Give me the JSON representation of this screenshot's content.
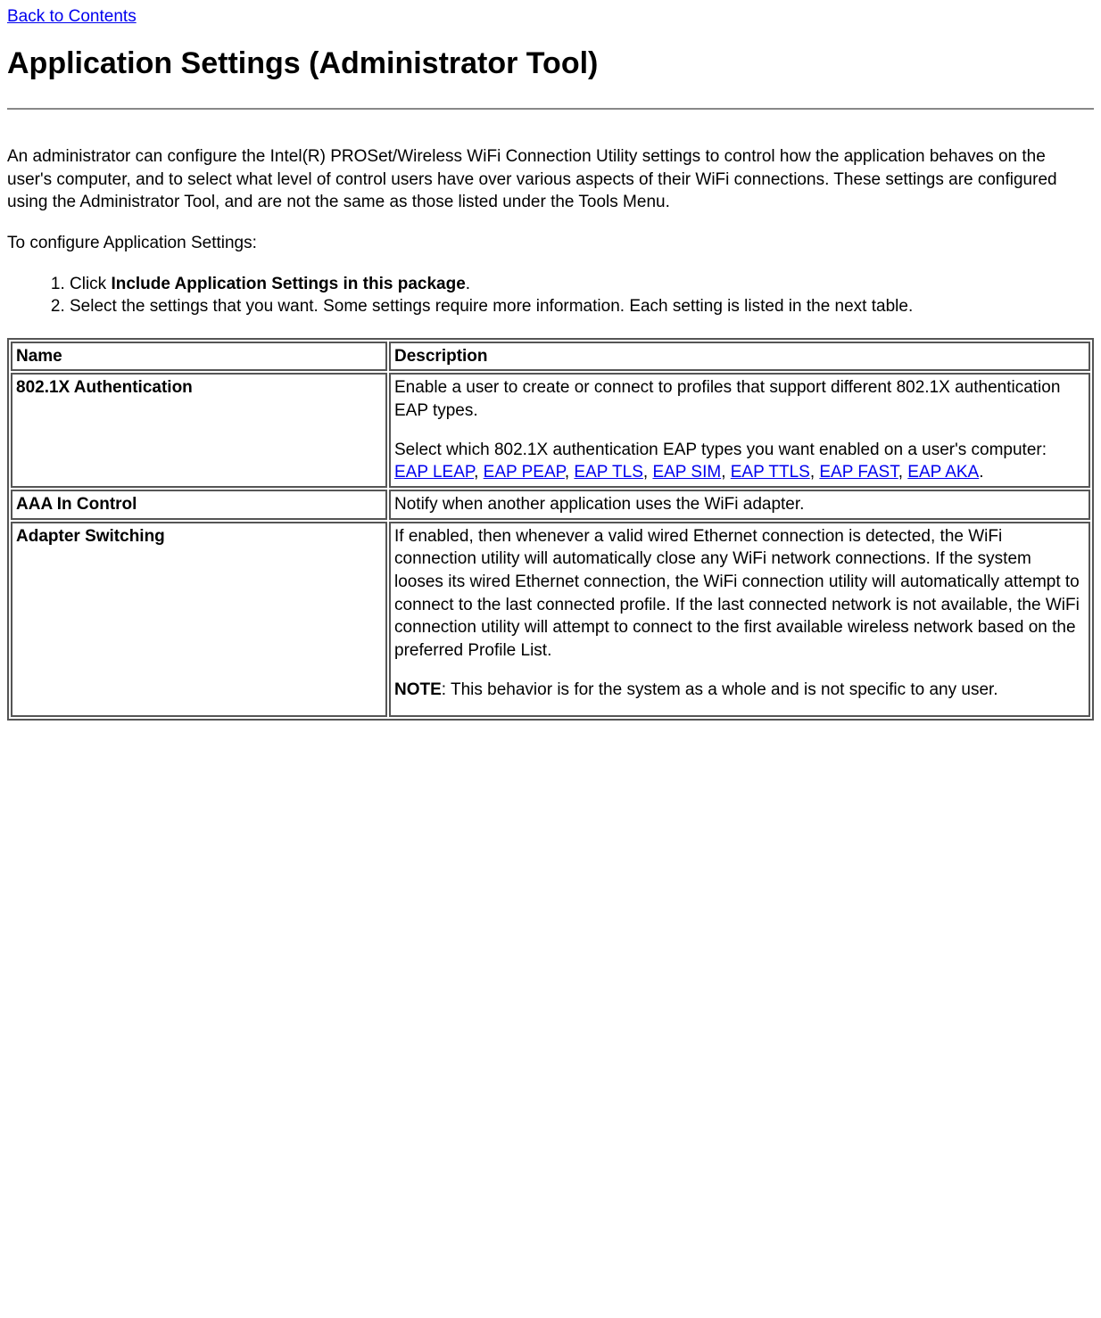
{
  "backLink": "Back to Contents",
  "heading": "Application Settings (Administrator Tool)",
  "intro": "An administrator can configure the Intel(R) PROSet/Wireless WiFi Connection Utility settings to control how the application behaves on the user's computer, and to select what level of control users have over various aspects of their WiFi connections. These settings are configured using the Administrator Tool, and are not the same as those listed under the Tools Menu.",
  "configureLabel": "To configure Application Settings:",
  "steps": {
    "s1_pre": "Click ",
    "s1_bold": "Include Application Settings in this package",
    "s1_post": ".",
    "s2": "Select the settings that you want. Some settings require more information. Each setting is listed in the next table."
  },
  "table": {
    "headerName": "Name",
    "headerDesc": "Description",
    "row1": {
      "name": "802.1X Authentication",
      "p1": "Enable a user to create or connect to profiles that support different 802.1X authentication EAP types.",
      "p2_pre": "Select which 802.1X authentication EAP types you want enabled on a user's computer: ",
      "links": {
        "l1": "EAP LEAP",
        "l2": "EAP PEAP",
        "l3": "EAP TLS",
        "l4": "EAP SIM",
        "l5": "EAP TTLS",
        "l6": "EAP FAST",
        "l7": "EAP AKA"
      },
      "sep": ", ",
      "period": "."
    },
    "row2": {
      "name": "AAA In Control",
      "desc": "Notify when another application uses the WiFi adapter."
    },
    "row3": {
      "name": "Adapter Switching",
      "p1": "If enabled, then whenever a valid wired Ethernet connection is detected, the WiFi connection utility will automatically close any WiFi network connections. If the system looses its wired Ethernet connection, the WiFi connection utility will automatically attempt to connect to the last connected profile. If the last connected network is not available, the WiFi connection utility will attempt to connect to the first available wireless network based on the preferred Profile List.",
      "noteLabel": "NOTE",
      "noteText": ": This behavior is for the system as a whole and is not specific to any user."
    }
  }
}
